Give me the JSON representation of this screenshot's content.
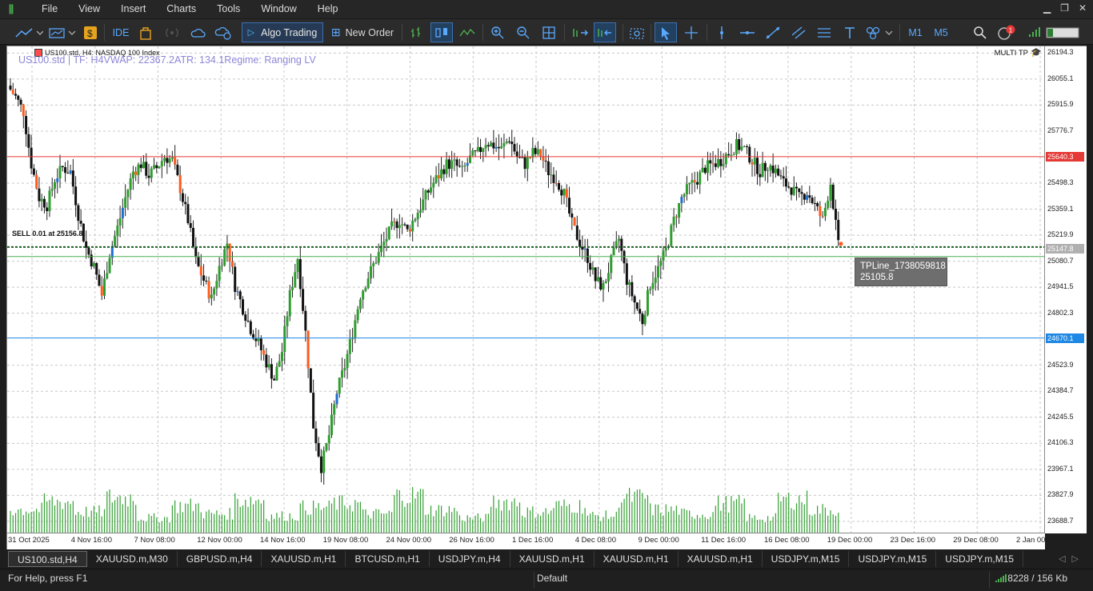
{
  "menu": [
    "File",
    "View",
    "Insert",
    "Charts",
    "Tools",
    "Window",
    "Help"
  ],
  "toolbar": {
    "ide_label": "IDE",
    "algo_trading_label": "Algo Trading",
    "new_order_label": "New Order",
    "timeframes": [
      "M1",
      "M5"
    ],
    "notification_count": "1",
    "icons": [
      "line-chart-icon",
      "indicators-icon",
      "dollar-icon",
      "ide-icon",
      "bag-icon",
      "signal-icon",
      "cloud-icon",
      "vps-icon",
      "play-icon",
      "new-order-icon",
      "bar-chart-icon",
      "candles-icon",
      "line-icon",
      "zoom-in-icon",
      "zoom-out-icon",
      "grid-icon",
      "autoscroll-icon",
      "shift-icon",
      "screenshot-icon",
      "cursor-icon",
      "crosshair-icon",
      "vertical-line-icon",
      "horizontal-line-icon",
      "trendline-icon",
      "channel-icon",
      "fibonacci-icon",
      "text-icon",
      "shapes-icon",
      "search-icon",
      "market-icon",
      "battery-icon"
    ]
  },
  "chart": {
    "title": "US100.std, H4:  NASDAQ 100 Index",
    "indicator_text": "US100.std | TF: H4VWAP: 22367.2ATR: 134.1Regime: Ranging LV",
    "multi_tp": "MULTI TP",
    "sell_label": "SELL 0.01 at 25156.8",
    "tooltip_name": "TPLine_1738059818",
    "tooltip_value": "25105.8",
    "price_ticks": [
      "26194.3",
      "26055.1",
      "25915.9",
      "25776.7",
      "25498.3",
      "25359.1",
      "25219.9",
      "25080.7",
      "24941.5",
      "24802.3",
      "24523.9",
      "24384.7",
      "24245.5",
      "24106.3",
      "23967.1",
      "23827.9",
      "23688.7"
    ],
    "badges": [
      {
        "value": "25640.3",
        "color": "#e53935"
      },
      {
        "value": "25147.8",
        "color": "#b0b0b0"
      },
      {
        "value": "24670.1",
        "color": "#1e88e5"
      }
    ],
    "time_labels": [
      "31 Oct 2025",
      "4 Nov 16:00",
      "7 Nov 08:00",
      "12 Nov 00:00",
      "14 Nov 16:00",
      "19 Nov 08:00",
      "24 Nov 00:00",
      "26 Nov 16:00",
      "1 Dec 16:00",
      "4 Dec 08:00",
      "9 Dec 00:00",
      "11 Dec 16:00",
      "16 Dec 08:00",
      "19 Dec 00:00",
      "23 Dec 16:00",
      "29 Dec 08:00",
      "2 Jan 00:00"
    ]
  },
  "chart_data": {
    "type": "candlestick",
    "symbol": "US100.std",
    "timeframe": "H4",
    "ylim": [
      23620,
      26230
    ],
    "horizontal_lines": [
      {
        "price": 25640.3,
        "color": "#e53935"
      },
      {
        "price": 25156.8,
        "color": "#1b5e20"
      },
      {
        "price": 25105.8,
        "color": "#4caf50"
      },
      {
        "price": 24670.1,
        "color": "#1e88e5"
      }
    ],
    "close_path": [
      26020,
      25960,
      25880,
      25600,
      25420,
      25380,
      25520,
      25580,
      25560,
      25330,
      25150,
      25050,
      24900,
      25120,
      25260,
      25420,
      25560,
      25600,
      25540,
      25580,
      25640,
      25620,
      25470,
      25300,
      25080,
      24980,
      24880,
      25050,
      25180,
      24950,
      24830,
      24720,
      24640,
      24540,
      24450,
      24600,
      24900,
      25100,
      24700,
      24200,
      23980,
      24150,
      24380,
      24520,
      24700,
      24900,
      25000,
      25090,
      25180,
      25260,
      25300,
      25240,
      25320,
      25400,
      25480,
      25540,
      25600,
      25600,
      25560,
      25630,
      25660,
      25720,
      25700,
      25680,
      25740,
      25640,
      25600,
      25660,
      25650,
      25560,
      25520,
      25440,
      25280,
      25180,
      25100,
      24980,
      24940,
      25080,
      25200,
      24980,
      24860,
      24760,
      24960,
      25040,
      25140,
      25300,
      25420,
      25480,
      25520,
      25580,
      25600,
      25620,
      25660,
      25700,
      25680,
      25620,
      25560,
      25600,
      25560,
      25500,
      25470,
      25420,
      25450,
      25380,
      25300,
      25500,
      25160
    ],
    "volume_path": [
      0.6,
      0.8,
      0.55,
      0.9,
      0.4,
      0.7,
      0.5,
      0.85,
      0.45,
      0.65,
      0.75,
      0.5,
      0.95,
      0.6,
      0.4,
      0.8,
      0.55,
      0.7,
      0.45,
      0.9,
      0.6,
      0.5,
      0.75,
      0.4,
      0.85,
      0.6,
      0.7
    ]
  },
  "tabs": [
    "US100.std,H4",
    "XAUUSD.m,M30",
    "GBPUSD.m,H4",
    "XAUUSD.m,H1",
    "BTCUSD.m,H1",
    "USDJPY.m,H4",
    "XAUUSD.m,H1",
    "XAUUSD.m,H1",
    "XAUUSD.m,H1",
    "USDJPY.m,M15",
    "USDJPY.m,M15",
    "USDJPY.m,M15"
  ],
  "status": {
    "help": "For Help, press F1",
    "profile": "Default",
    "connection": "8228 / 156 Kb"
  }
}
